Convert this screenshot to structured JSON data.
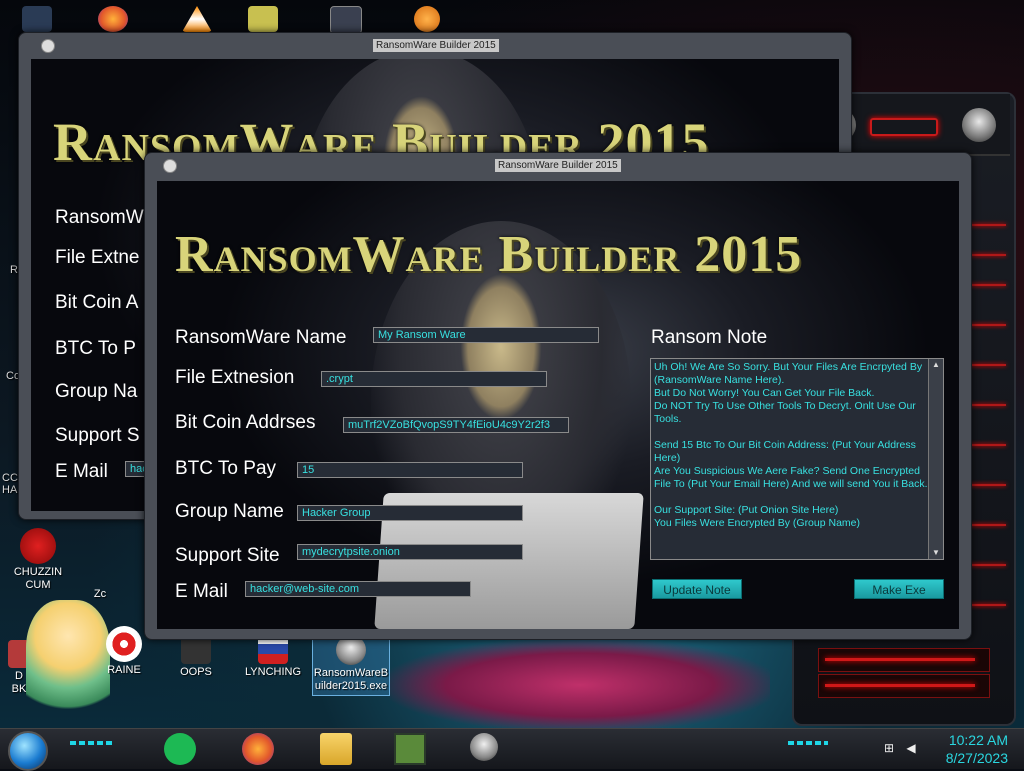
{
  "desktop": {
    "icons": [
      {
        "label": "CHUZZIN\nCUM"
      },
      {
        "label": "Zc"
      },
      {
        "label": "D\nBK"
      },
      {
        "label": "RAINE"
      },
      {
        "label": "OOPS"
      },
      {
        "label": "LYNCHING"
      },
      {
        "label": "RansomWareB\nuilder2015.exe"
      }
    ],
    "side_fragments": {
      "re": "Re",
      "co": "Co",
      "cc": "CC\nHA"
    }
  },
  "back_window": {
    "title": "RansomWare Builder 2015",
    "logo": "RansomWare Builder 2015",
    "labels": [
      "RansomW",
      "File Extne",
      "Bit Coin A",
      "BTC To P",
      "Group Na",
      "Support S",
      "E Mail"
    ],
    "email_fragment": "hac"
  },
  "front_window": {
    "title": "RansomWare Builder 2015",
    "logo": "RansomWare Builder 2015",
    "fields": {
      "name_label": "RansomWare Name",
      "name_value": "My Ransom Ware",
      "ext_label": "File Extnesion",
      "ext_value": ".crypt",
      "btc_addr_label": "Bit Coin Addrses",
      "btc_addr_value": "muTrf2VZoBfQvopS9TY4fEioU4c9Y2r2f3",
      "btc_pay_label": "BTC To Pay",
      "btc_pay_value": "15",
      "group_label": "Group Name",
      "group_value": "Hacker Group",
      "site_label": "Support Site",
      "site_value": "mydecrytpsite.onion",
      "email_label": "E Mail",
      "email_value": "hacker@web-site.com"
    },
    "note_label": "Ransom Note",
    "note_text": "Uh Oh! We Are So Sorry. But Your Files Are Encrpyted By (RansomWare Name Here).\nBut Do Not Worry! You Can Get Your File Back.\nDo NOT Try To Use Other Tools To Decryt. Onlt Use Our Tools.\n\nSend 15 Btc To Our Bit Coin Address: (Put Your Address Here)\nAre You Suspicious We Aere Fake? Send One Encrypted File To (Put Your Email Here) And we will send You it Back.\n\nOur Support Site: (Put Onion Site Here)\nYou Files Were Encrypted By (Group Name)",
    "update_button": "Update Note",
    "make_button": "Make Exe"
  },
  "taskbar": {
    "time": "10:22 AM",
    "date": "8/27/2023",
    "apps": [
      "start-orb",
      "notes-app-icon",
      "firefox-icon",
      "file-explorer-icon",
      "minecraft-icon",
      "ransomware-builder-icon"
    ]
  },
  "colors": {
    "accent_cyan": "#2ad7e0",
    "logo_gold": "#d8d47a",
    "hud_red": "#d01818"
  }
}
